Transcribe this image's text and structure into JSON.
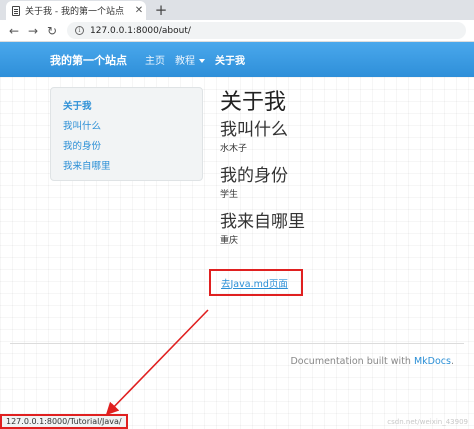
{
  "browser": {
    "tab_title": "关于我 - 我的第一个站点",
    "tab_close": "✕",
    "new_tab": "+",
    "url": "127.0.0.1:8000/about/"
  },
  "navbar": {
    "brand": "我的第一个站点",
    "items": [
      {
        "label": "主页"
      },
      {
        "label": "教程"
      },
      {
        "label": "关于我"
      }
    ]
  },
  "toc": {
    "items": [
      {
        "label": "关于我"
      },
      {
        "label": "我叫什么"
      },
      {
        "label": "我的身份"
      },
      {
        "label": "我来自哪里"
      }
    ]
  },
  "main": {
    "title": "关于我",
    "sections": [
      {
        "heading": "我叫什么",
        "text": "水木子"
      },
      {
        "heading": "我的身份",
        "text": "学生"
      },
      {
        "heading": "我来自哪里",
        "text": "重庆"
      }
    ],
    "link": "去Java.md页面"
  },
  "footer": {
    "text": "Documentation built with ",
    "mkdocs": "MkDocs",
    "period": "."
  },
  "status": {
    "url": "127.0.0.1:8000/Tutorial/Java/"
  },
  "annotation": {
    "color": "#e02020"
  }
}
